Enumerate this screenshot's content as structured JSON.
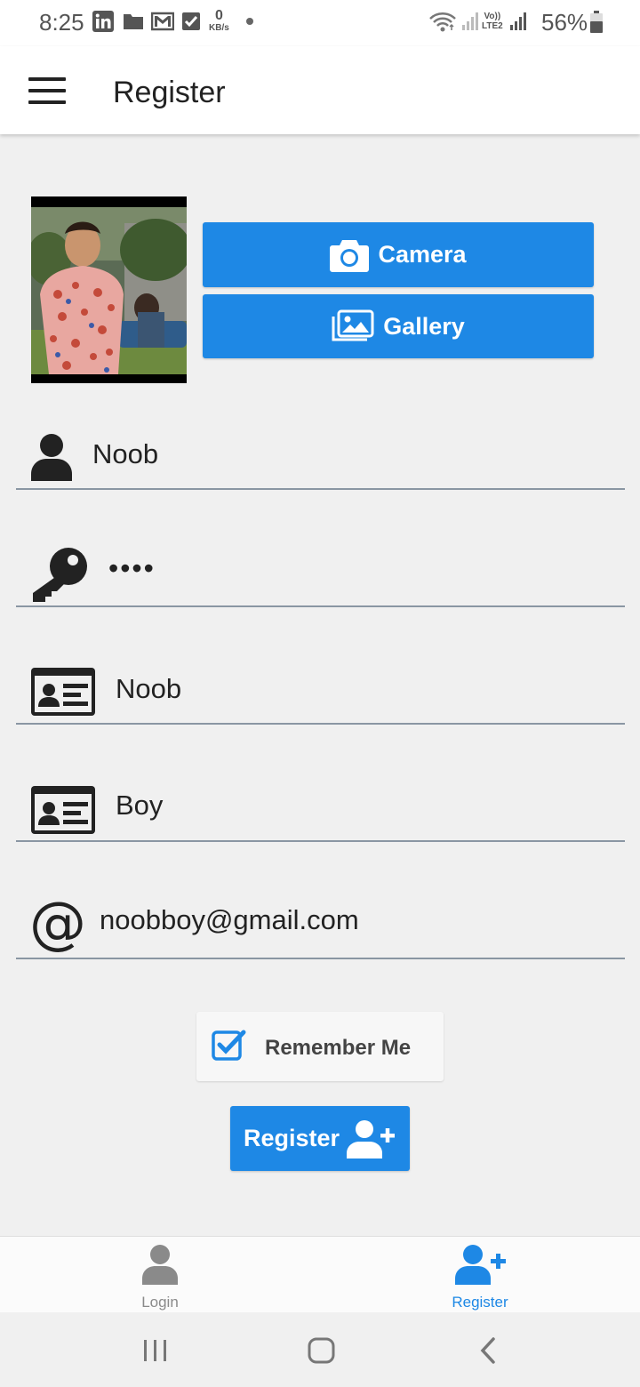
{
  "status_bar": {
    "time": "8:25",
    "kbs_value": "0",
    "kbs_unit": "KB/s",
    "volte": "Vo))",
    "lte": "LTE2",
    "battery": "56%"
  },
  "app_bar": {
    "title": "Register"
  },
  "photo_section": {
    "camera_label": "Camera",
    "gallery_label": "Gallery"
  },
  "form": {
    "username": "Noob",
    "password": "••••",
    "first_name": "Noob",
    "last_name": "Boy",
    "email": "noobboy@gmail.com"
  },
  "remember_me": {
    "label": "Remember Me",
    "checked": true
  },
  "register_button": {
    "label": "Register"
  },
  "bottom_nav": {
    "items": [
      {
        "label": "Login",
        "active": false
      },
      {
        "label": "Register",
        "active": true
      }
    ]
  },
  "colors": {
    "accent": "#1e88e5",
    "background": "#f0f0f0",
    "inactive": "#8a8a8a"
  }
}
